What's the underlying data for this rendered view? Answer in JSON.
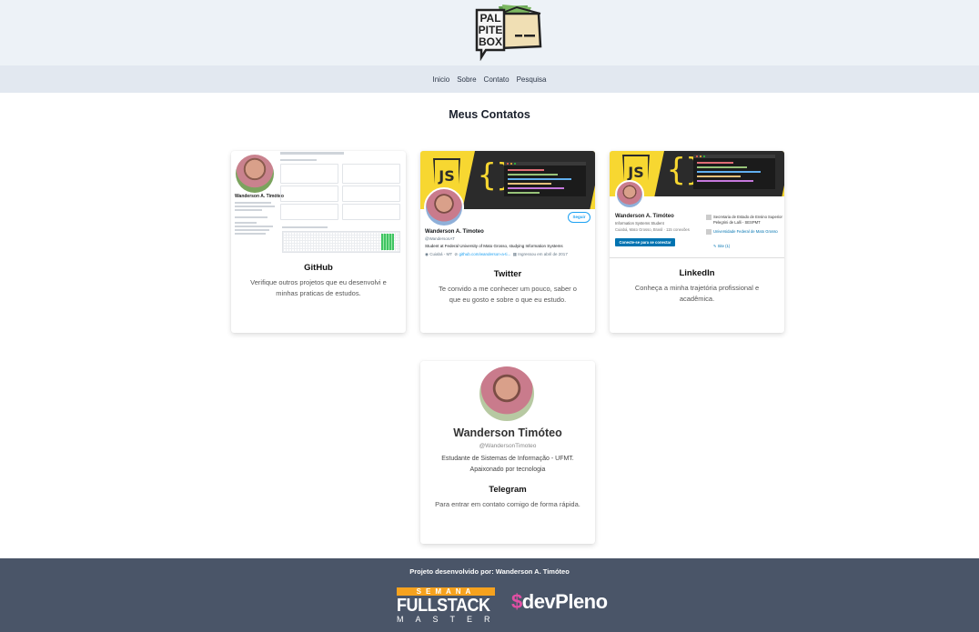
{
  "header": {
    "logo_text": [
      "PAL",
      "PITE",
      "BOX"
    ]
  },
  "nav": {
    "items": [
      "Inicio",
      "Sobre",
      "Contato",
      "Pesquisa"
    ]
  },
  "page_title": "Meus Contatos",
  "cards": {
    "github": {
      "title": "GitHub",
      "description": "Verifique outros projetos que eu desenvolvi e minhas praticas de estudos.",
      "preview_name": "Wanderson A. Timóteo"
    },
    "twitter": {
      "title": "Twitter",
      "description": "Te convido a me conhecer um pouco, saber o que eu gosto e sobre o que eu estudo.",
      "preview": {
        "name": "Wanderson A. Timoteo",
        "handle": "@WandersonAT",
        "bio": "Student at Federal University of Mato Grosso, studying Information Systems",
        "location": "Cuiabá - MT",
        "link": "github.com/wanderson-a-ti...",
        "joined": "Ingressou em abril de 2017",
        "follow_label": "Seguir",
        "logo_text": "JS",
        "brace": "{}"
      }
    },
    "linkedin": {
      "title": "LinkedIn",
      "description": "Conheça a minha trajetória profissional e acadêmica.",
      "preview": {
        "name": "Wanderson A. Timóteo",
        "headline": "Information Systems Student",
        "location": "Cuiabá, Mato Grosso, Brasil · 115 conexões",
        "connect_label": "Conecte-se para se conectar",
        "edu1": "Secretaria de Estado de Ensino Superior Pelegrini de Lalli - SESPMT",
        "edu2": "Universidade Federal de Mato Grosso",
        "link": "Site (1)",
        "logo_text": "JS",
        "brace": "{}"
      }
    },
    "telegram": {
      "title": "Telegram",
      "description": "Para entrar em contato comigo de forma rápida.",
      "preview": {
        "name": "Wanderson Timóteo",
        "handle": "@WandersonTimoteo",
        "bio": "Estudante de Sistemas de Informação - UFMT. Apaixonado por tecnologia"
      }
    }
  },
  "footer": {
    "credit": "Projeto desenvolvido por: Wanderson A. Timóteo",
    "fullstack": {
      "top": "SEMANA",
      "middle": "FULLSTACK",
      "bottom": "MASTER"
    },
    "devpleno": {
      "symbol": "$",
      "text": "devPleno"
    }
  },
  "colors": {
    "topbar": "#edf2f7",
    "navbar": "#e2e8f0",
    "footer": "#4a5568",
    "js_yellow": "#f7d731",
    "twitter_blue": "#1da1f2",
    "linkedin_blue": "#0073b1",
    "devpleno_pink": "#e24fa4",
    "fullstack_orange": "#f6a21e"
  }
}
